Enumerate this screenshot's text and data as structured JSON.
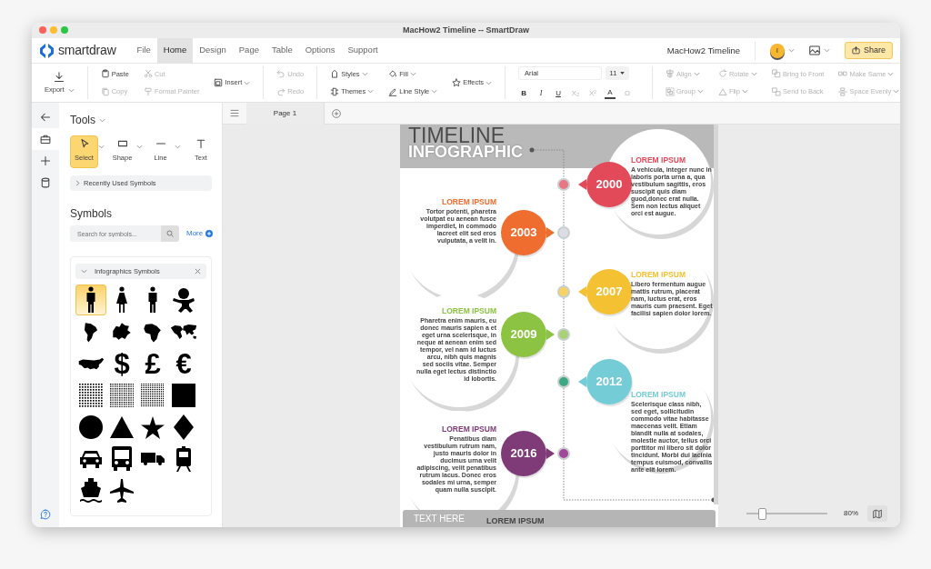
{
  "window": {
    "title": "MacHow2 Timeline -- SmartDraw"
  },
  "menu": {
    "logo": "smartdraw",
    "tabs": [
      {
        "label": "File",
        "selected": false
      },
      {
        "label": "Home",
        "selected": true
      },
      {
        "label": "Design",
        "selected": false
      },
      {
        "label": "Page",
        "selected": false
      },
      {
        "label": "Table",
        "selected": false
      },
      {
        "label": "Options",
        "selected": false
      },
      {
        "label": "Support",
        "selected": false
      }
    ],
    "document_name": "MacHow2 Timeline",
    "avatar": "I",
    "share": "Share"
  },
  "ribbon": {
    "sections": [
      {
        "kind": "export",
        "label": "Export"
      },
      {
        "kind": "buttons",
        "columns": [
          [
            {
              "label": "Paste",
              "disabled": false,
              "caret": false
            },
            {
              "label": "Copy",
              "disabled": true,
              "caret": false
            }
          ],
          [
            {
              "label": "Cut",
              "disabled": true,
              "caret": false
            },
            {
              "label": "Format Painter",
              "disabled": true,
              "caret": false
            }
          ],
          [
            {
              "label": "Insert",
              "disabled": false,
              "caret": true
            }
          ]
        ]
      },
      {
        "kind": "buttons",
        "columns": [
          [
            {
              "label": "Undo",
              "disabled": true,
              "caret": false
            },
            {
              "label": "Redo",
              "disabled": true,
              "caret": false
            }
          ]
        ]
      },
      {
        "kind": "buttons",
        "columns": [
          [
            {
              "label": "Styles",
              "disabled": false,
              "caret": true
            },
            {
              "label": "Themes",
              "disabled": false,
              "caret": true
            }
          ],
          [
            {
              "label": "Fill",
              "disabled": false,
              "caret": true
            },
            {
              "label": "Line Style",
              "disabled": false,
              "caret": true
            }
          ],
          [
            {
              "label": "Effects",
              "disabled": false,
              "caret": true
            }
          ]
        ]
      },
      {
        "kind": "font",
        "font": "Arial",
        "size": "11",
        "format": [
          {
            "label": "B",
            "disabled": false
          },
          {
            "label": "I",
            "disabled": false
          },
          {
            "label": "U",
            "disabled": false
          },
          {
            "label": "X₂",
            "disabled": true
          },
          {
            "label": "X²",
            "disabled": true
          },
          {
            "label": "A",
            "disabled": false
          },
          {
            "label": "Ω",
            "disabled": true
          }
        ]
      },
      {
        "kind": "buttons",
        "columns": [
          [
            {
              "label": "Align",
              "disabled": true,
              "caret": true
            },
            {
              "label": "Group",
              "disabled": true,
              "caret": true
            }
          ],
          [
            {
              "label": "Rotate",
              "disabled": true,
              "caret": true
            },
            {
              "label": "Flip",
              "disabled": true,
              "caret": true
            }
          ],
          [
            {
              "label": "Bring to Front",
              "disabled": true,
              "caret": false
            },
            {
              "label": "Send to Back",
              "disabled": true,
              "caret": false
            }
          ],
          [
            {
              "label": "Make Same",
              "disabled": true,
              "caret": true
            },
            {
              "label": "Space Evenly",
              "disabled": true,
              "caret": true
            }
          ]
        ]
      }
    ]
  },
  "rail": [
    {
      "kind": "back",
      "selected": false
    },
    {
      "kind": "toolbox",
      "selected": true
    },
    {
      "kind": "plus",
      "selected": false
    },
    {
      "kind": "database",
      "selected": false
    }
  ],
  "panel": {
    "tools_title": "Tools",
    "tools": [
      {
        "label": "Select",
        "selected": true,
        "caret": true
      },
      {
        "label": "Shape",
        "selected": false,
        "caret": true
      },
      {
        "label": "Line",
        "selected": false,
        "caret": true
      },
      {
        "label": "Text",
        "selected": false,
        "caret": false
      }
    ],
    "recent": "Recently Used Symbols",
    "symbols_title": "Symbols",
    "search": {
      "placeholder": "Search for symbols..."
    },
    "more": "More",
    "library": {
      "title": "Infographics Symbols",
      "symbols": [
        {
          "kind": "man",
          "selected": true
        },
        {
          "kind": "woman",
          "selected": false
        },
        {
          "kind": "man",
          "selected": false
        },
        {
          "kind": "baby",
          "selected": false
        },
        {
          "kind": "map",
          "selected": false
        },
        {
          "kind": "map",
          "selected": false
        },
        {
          "kind": "map",
          "selected": false
        },
        {
          "kind": "map",
          "selected": false
        },
        {
          "kind": "map",
          "selected": false
        },
        {
          "kind": "glyph",
          "text": "$",
          "selected": false
        },
        {
          "kind": "glyph",
          "text": "£",
          "selected": false
        },
        {
          "kind": "glyph",
          "text": "€",
          "selected": false
        },
        {
          "kind": "dots",
          "selected": false
        },
        {
          "kind": "dots",
          "selected": false
        },
        {
          "kind": "dots",
          "selected": false
        },
        {
          "kind": "square",
          "selected": false
        },
        {
          "kind": "circle",
          "selected": false
        },
        {
          "kind": "triangle",
          "selected": false
        },
        {
          "kind": "star",
          "selected": false
        },
        {
          "kind": "diamond",
          "selected": false
        },
        {
          "kind": "car",
          "selected": false
        },
        {
          "kind": "bus",
          "selected": false
        },
        {
          "kind": "truck",
          "selected": false
        },
        {
          "kind": "train",
          "selected": false
        },
        {
          "kind": "ship",
          "selected": false
        },
        {
          "kind": "plane",
          "selected": false
        }
      ]
    }
  },
  "canvas": {
    "page_tab": "Page 1",
    "zoom": {
      "level": 0.19,
      "reading": "80%"
    },
    "infographic": {
      "title": "TIMELINE",
      "subtitle": "INFOGRAPHIC",
      "entries": [
        {
          "kind": "right",
          "year": "2000",
          "title": "LOREM IPSUM",
          "text": "A vehicula, integer nunc in laboris porta urna a, qua vestibulum sagittis, eros suscipit quis diam guod,donec erat nulla. Sem non lectus aliquet orci est augue.",
          "color": "#e24a5a"
        },
        {
          "kind": "left",
          "year": "2003",
          "title": "LOREM IPSUM",
          "text": "Tortor potenti, pharetra volutpat eu aenean fusce imperdiet, in commodo lacreet elit sed eros vulputata, a velit in.",
          "color": "#ee6d2f"
        },
        {
          "kind": "right",
          "year": "2007",
          "title": "LOREM IPSUM",
          "text": "Libero fermentum augue mattis rutrum, placerat nam, luctus erat, eros mauris cum praesent. Eget facilisi sapien dolor lorem.",
          "color": "#f4c133"
        },
        {
          "kind": "left",
          "year": "2009",
          "title": "LOREM IPSUM",
          "text": "Pharetra enim mauris, eu donec mauris sapien a et eget urna scelerisque, in neque at aenean enim sed tempor, vel nam id luctus arcu, nibh quis magnis sed sociis vitae. Semper nulla eget lectus distinctio id lobortis.",
          "color": "#8cc343"
        },
        {
          "kind": "right",
          "year": "2012",
          "title": "LOREM IPSUM",
          "text": "Scelerisque class nibh, sed eget, sollicitudin commodo vitae habitasse maecenas velit. Etiam blandit nulla at sodales, molestie auctor, tellus orci porttitor mi libero sit dolor tincidunt. Morbi dui lacinia tempus euismod, convallis ante elit lorem.",
          "color": "#74ccd6"
        },
        {
          "kind": "left",
          "year": "2016",
          "title": "LOREM IPSUM",
          "text": "Penatibus diam vestibulum rutrum nam, justo mauris dolor in ducimus urna velit adipiscing, velit penatibus rutrum lacus. Donec eros sodales mi urna, semper quam nulla suscipit.",
          "color": "#7f3a78"
        }
      ],
      "nodes": [
        {
          "color": "#ea7683"
        },
        {
          "color": "#dcdce6"
        },
        {
          "color": "#f8d263"
        },
        {
          "color": "#a9d272"
        },
        {
          "color": "#3ea784"
        },
        {
          "color": "#a2489b"
        }
      ],
      "footer": {
        "label": "TEXT HERE",
        "title": "LOREM IPSUM"
      }
    }
  }
}
